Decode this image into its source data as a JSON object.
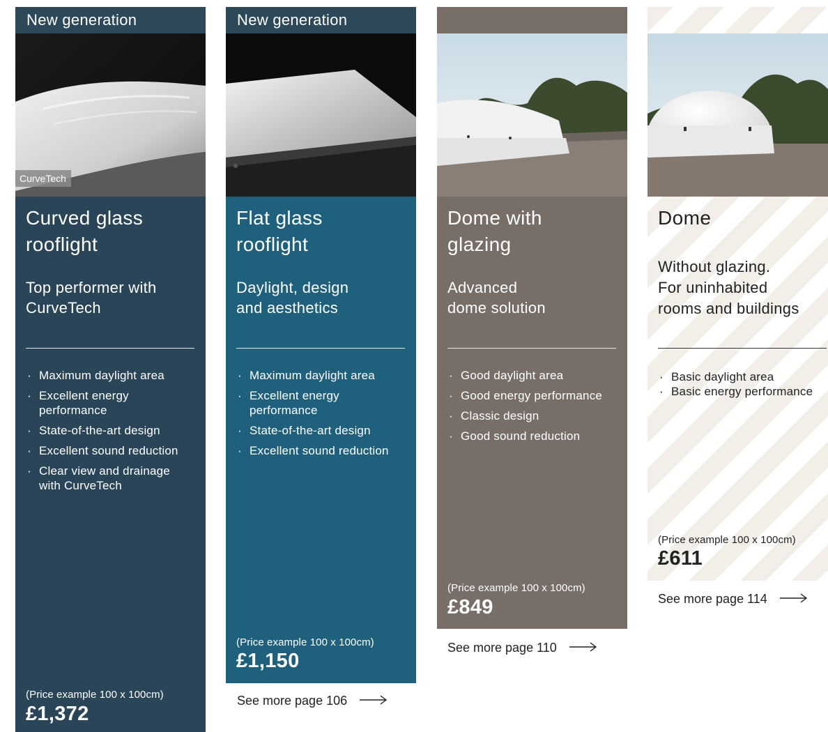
{
  "cards": [
    {
      "band_label": "New generation",
      "photo": "curved-glass-rooflight-photo",
      "photo_logo": "CurveTech",
      "title_lines": [
        "Curved glass",
        "rooflight"
      ],
      "subtitle_lines": [
        "Top performer with",
        "CurveTech"
      ],
      "features": [
        "Maximum daylight area",
        "Excellent energy",
        "performance",
        "State-of-the-art design",
        "Excellent sound reduction",
        "Clear view and drainage",
        "with CurveTech"
      ],
      "price_note": "(Price example 100 x 100cm)",
      "price": "£1,372",
      "background_color": "#2a4557"
    },
    {
      "band_label": "New generation",
      "photo": "flat-glass-rooflight-photo",
      "title_lines": [
        "Flat glass",
        "rooflight"
      ],
      "subtitle_lines": [
        "Daylight, design",
        "and aesthetics"
      ],
      "features": [
        "Maximum daylight area",
        "Excellent energy",
        "performance",
        "State-of-the-art design",
        "Excellent sound reduction"
      ],
      "price_note": "(Price example 100 x 100cm)",
      "price": "£1,150",
      "see_more": "See more page 106",
      "background_color": "#1f617d"
    },
    {
      "band_label": "",
      "photo": "dome-with-glazing-photo",
      "title_lines": [
        "Dome with",
        "glazing"
      ],
      "subtitle_lines": [
        "Advanced",
        "dome solution"
      ],
      "features": [
        "Good daylight area",
        "Good energy performance",
        "Classic design",
        "Good sound reduction"
      ],
      "price_note": "(Price example 100 x 100cm)",
      "price": "£849",
      "see_more": "See more page 110",
      "background_color": "#776f67"
    },
    {
      "band_label": "",
      "photo": "dome-photo",
      "title_lines": [
        "Dome"
      ],
      "subtitle_lines": [
        "Without glazing.",
        "For uninhabited",
        "rooms and buildings"
      ],
      "features": [
        "Basic daylight area",
        "Basic energy performance"
      ],
      "price_note": "(Price example 100 x 100cm)",
      "price": "£611",
      "see_more": "See more page 114",
      "background_color": "#f2efe8"
    }
  ],
  "icons": {
    "arrow": "right-arrow-icon"
  }
}
